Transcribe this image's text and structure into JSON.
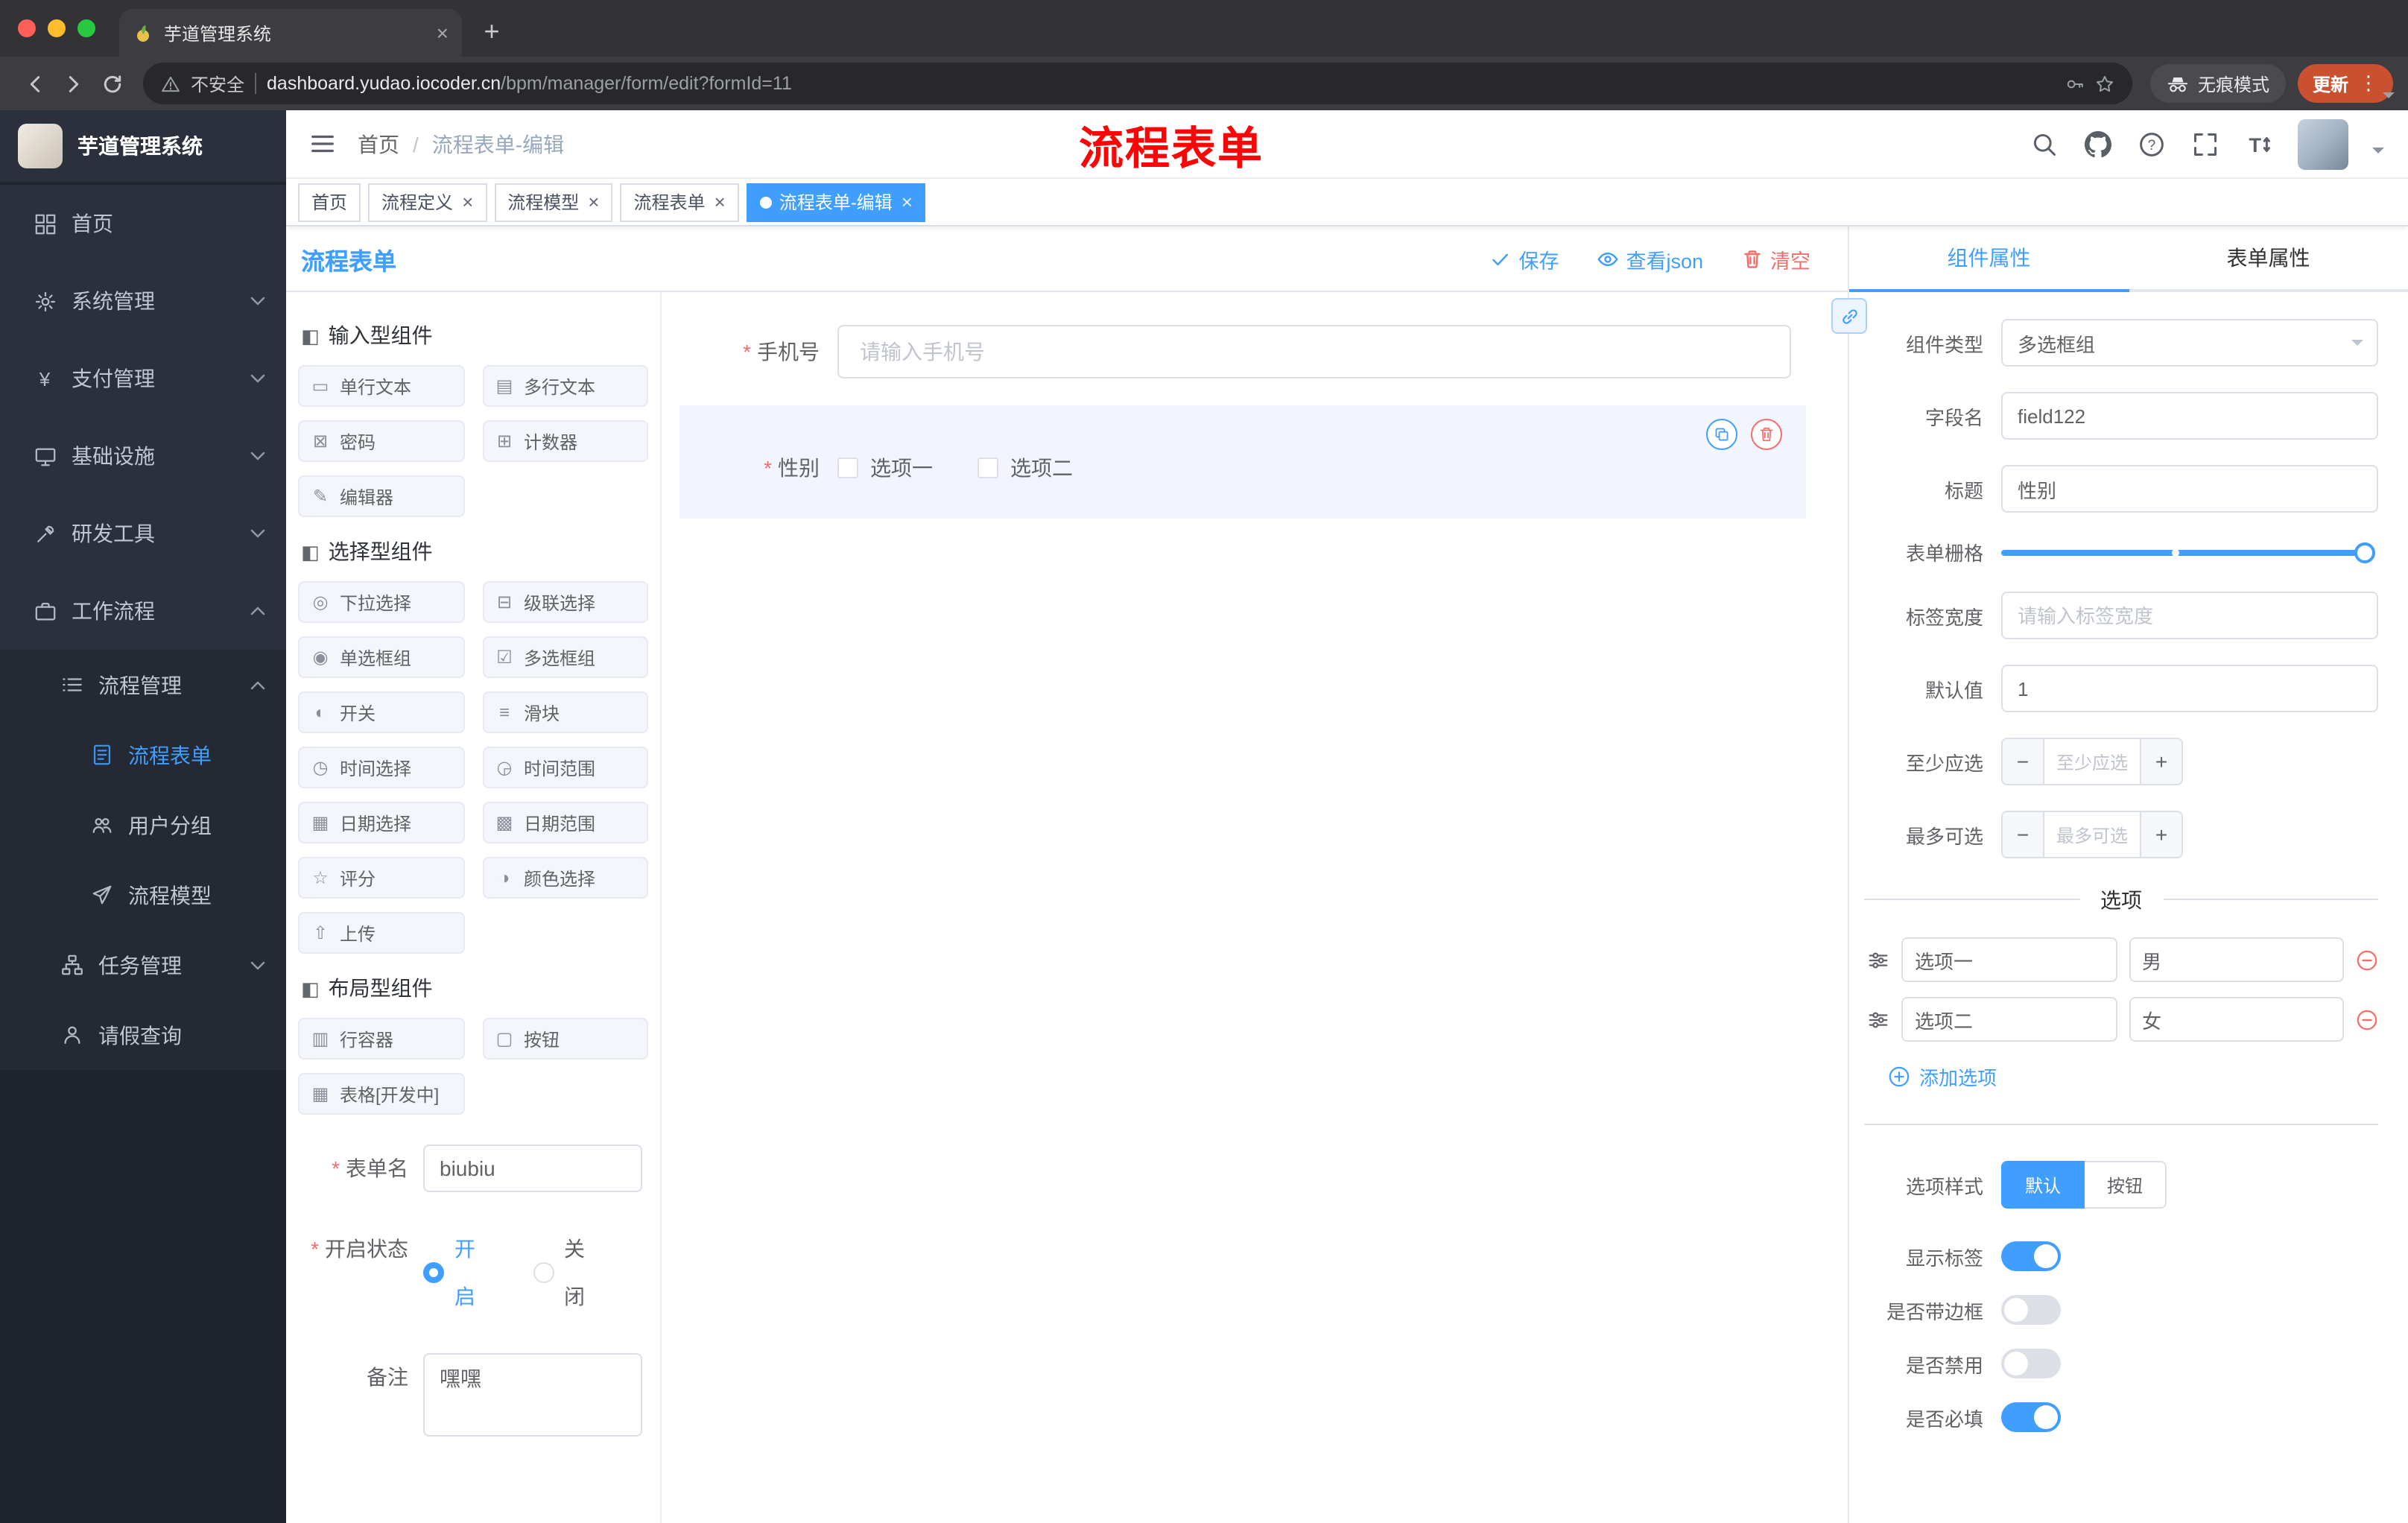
{
  "browser": {
    "tab_title": "芋道管理系统",
    "security_label": "不安全",
    "url_host": "dashboard.yudao.iocoder.cn",
    "url_path": "/bpm/manager/form/edit?formId=11",
    "incognito_label": "无痕模式",
    "update_label": "更新"
  },
  "sidebar": {
    "app_title": "芋道管理系统",
    "items": [
      {
        "id": "home",
        "label": "首页",
        "icon": "dashboard",
        "level": 1
      },
      {
        "id": "system",
        "label": "系统管理",
        "icon": "gear",
        "level": 1,
        "chevron": "down"
      },
      {
        "id": "payment",
        "label": "支付管理",
        "icon": "yen",
        "level": 1,
        "chevron": "down"
      },
      {
        "id": "infra",
        "label": "基础设施",
        "icon": "infra",
        "level": 1,
        "chevron": "down"
      },
      {
        "id": "devtools",
        "label": "研发工具",
        "icon": "tool",
        "level": 1,
        "chevron": "down"
      },
      {
        "id": "workflow",
        "label": "工作流程",
        "icon": "briefcase",
        "level": 1,
        "chevron": "up"
      },
      {
        "id": "process-mgmt",
        "label": "流程管理",
        "icon": "list",
        "level": 2,
        "chevron": "up"
      },
      {
        "id": "process-form",
        "label": "流程表单",
        "icon": "doc",
        "level": 3,
        "active": true
      },
      {
        "id": "user-group",
        "label": "用户分组",
        "icon": "group",
        "level": 3
      },
      {
        "id": "process-model",
        "label": "流程模型",
        "icon": "send",
        "level": 3
      },
      {
        "id": "task-mgmt",
        "label": "任务管理",
        "icon": "tree",
        "level": 2,
        "chevron": "down"
      },
      {
        "id": "leave-query",
        "label": "请假查询",
        "icon": "user",
        "level": 2
      }
    ]
  },
  "header": {
    "breadcrumb": [
      "首页",
      "流程表单-编辑"
    ],
    "breadcrumb_sep": "/",
    "annotation": "流程表单"
  },
  "tags": [
    {
      "label": "首页",
      "closable": false,
      "active": false
    },
    {
      "label": "流程定义",
      "closable": true,
      "active": false
    },
    {
      "label": "流程模型",
      "closable": true,
      "active": false
    },
    {
      "label": "流程表单",
      "closable": true,
      "active": false
    },
    {
      "label": "流程表单-编辑",
      "closable": true,
      "active": true
    }
  ],
  "designer": {
    "title": "流程表单",
    "actions": {
      "save": "保存",
      "view_json": "查看json",
      "clear": "清空"
    },
    "palette": [
      {
        "title": "输入型组件",
        "items": [
          {
            "icon": "single-text",
            "label": "单行文本"
          },
          {
            "icon": "multi-text",
            "label": "多行文本"
          },
          {
            "icon": "password",
            "label": "密码"
          },
          {
            "icon": "counter",
            "label": "计数器"
          },
          {
            "icon": "editor",
            "label": "编辑器"
          }
        ]
      },
      {
        "title": "选择型组件",
        "items": [
          {
            "icon": "select",
            "label": "下拉选择"
          },
          {
            "icon": "cascader",
            "label": "级联选择"
          },
          {
            "icon": "radio-group",
            "label": "单选框组"
          },
          {
            "icon": "checkbox-group",
            "label": "多选框组"
          },
          {
            "icon": "switch",
            "label": "开关"
          },
          {
            "icon": "slider",
            "label": "滑块"
          },
          {
            "icon": "time",
            "label": "时间选择"
          },
          {
            "icon": "time-range",
            "label": "时间范围"
          },
          {
            "icon": "date",
            "label": "日期选择"
          },
          {
            "icon": "date-range",
            "label": "日期范围"
          },
          {
            "icon": "rate",
            "label": "评分"
          },
          {
            "icon": "color",
            "label": "颜色选择"
          },
          {
            "icon": "upload",
            "label": "上传"
          }
        ]
      },
      {
        "title": "布局型组件",
        "items": [
          {
            "icon": "row",
            "label": "行容器"
          },
          {
            "icon": "button",
            "label": "按钮"
          },
          {
            "icon": "table",
            "label": "表格[开发中]"
          }
        ]
      }
    ],
    "canvas": {
      "phone": {
        "label": "手机号",
        "required": true,
        "placeholder": "请输入手机号"
      },
      "gender": {
        "label": "性别",
        "required": true,
        "options": [
          "选项一",
          "选项二"
        ]
      }
    },
    "meta": {
      "form_name_label": "表单名",
      "form_name_value": "biubiu",
      "status_label": "开启状态",
      "status_on": "开启",
      "status_off": "关闭",
      "remark_label": "备注",
      "remark_value": "嘿嘿"
    }
  },
  "props": {
    "tabs": [
      "组件属性",
      "表单属性"
    ],
    "component_type_label": "组件类型",
    "component_type_value": "多选框组",
    "field_name_label": "字段名",
    "field_name_value": "field122",
    "title_label": "标题",
    "title_value": "性别",
    "grid_label": "表单栅格",
    "label_width_label": "标签宽度",
    "label_width_placeholder": "请输入标签宽度",
    "default_label": "默认值",
    "default_value": "1",
    "min_label": "至少应选",
    "min_placeholder": "至少应选",
    "max_label": "最多可选",
    "max_placeholder": "最多可选",
    "options_title": "选项",
    "options": [
      {
        "label": "选项一",
        "value": "男"
      },
      {
        "label": "选项二",
        "value": "女"
      }
    ],
    "add_option_label": "添加选项",
    "style_label": "选项样式",
    "style_options": [
      "默认",
      "按钮"
    ],
    "style_selected": "默认",
    "switches": [
      {
        "label": "显示标签",
        "on": true
      },
      {
        "label": "是否带边框",
        "on": false
      },
      {
        "label": "是否禁用",
        "on": false
      },
      {
        "label": "是否必填",
        "on": true
      }
    ],
    "colors": {
      "accent": "#409eff",
      "danger": "#f56c6c"
    }
  }
}
